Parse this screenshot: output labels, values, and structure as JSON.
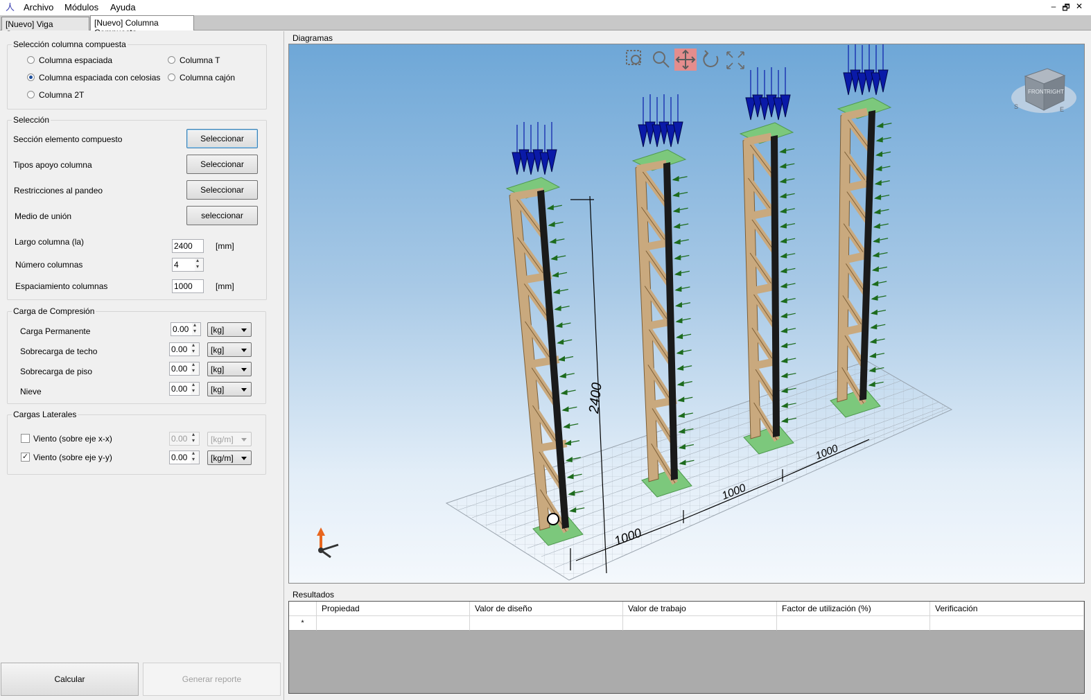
{
  "menu": {
    "archivo": "Archivo",
    "modulos": "Módulos",
    "ayuda": "Ayuda"
  },
  "window_buttons": {
    "minimize": "–",
    "restore": "🗗",
    "close": "✕"
  },
  "tabs": [
    {
      "label": "[Nuevo] Viga Compuesta",
      "active": false
    },
    {
      "label": "[Nuevo] Columna Compuesta",
      "active": true
    }
  ],
  "seleccion_columna": {
    "title": "Selección columna compuesta",
    "options": {
      "espaciada": {
        "label": "Columna espaciada",
        "checked": false
      },
      "celosias": {
        "label": "Columna espaciada con celosias",
        "checked": true
      },
      "dos_t": {
        "label": "Columna 2T",
        "checked": false
      },
      "t": {
        "label": "Columna T",
        "checked": false
      },
      "cajon": {
        "label": "Columna cajón",
        "checked": false
      }
    }
  },
  "seleccion": {
    "title": "Selección",
    "seccion": {
      "label": "Sección elemento compuesto",
      "button": "Seleccionar"
    },
    "apoyo": {
      "label": "Tipos apoyo columna",
      "button": "Seleccionar"
    },
    "pandeo": {
      "label": "Restricciones al pandeo",
      "button": "Seleccionar"
    },
    "union": {
      "label": "Medio de unión",
      "button": "seleccionar"
    },
    "largo": {
      "label": "Largo columna (la)",
      "value": "2400",
      "unit": "[mm]"
    },
    "numero": {
      "label": "Número columnas",
      "value": "4"
    },
    "espaciamiento": {
      "label": "Espaciamiento columnas",
      "value": "1000",
      "unit": "[mm]"
    }
  },
  "carga_compresion": {
    "title": "Carga de Compresión",
    "rows": {
      "permanente": {
        "label": "Carga Permanente",
        "value": "0.00",
        "unit": "[kg]"
      },
      "techo": {
        "label": "Sobrecarga de techo",
        "value": "0.00",
        "unit": "[kg]"
      },
      "piso": {
        "label": "Sobrecarga de piso",
        "value": "0.00",
        "unit": "[kg]"
      },
      "nieve": {
        "label": "Nieve",
        "value": "0.00",
        "unit": "[kg]"
      }
    }
  },
  "cargas_laterales": {
    "title": "Cargas Laterales",
    "xx": {
      "label": "Viento (sobre eje x-x)",
      "checked": false,
      "value": "0.00",
      "unit": "[kg/m]"
    },
    "yy": {
      "label": "Viento (sobre eje y-y)",
      "checked": true,
      "value": "0.00",
      "unit": "[kg/m]"
    }
  },
  "diagramas": {
    "title": "Diagramas",
    "toolbar": [
      "zoom-window-icon",
      "zoom-icon",
      "pan-icon",
      "rotate-icon",
      "fit-view-icon"
    ],
    "dimensions": {
      "height": "2400",
      "spacing1": "1000",
      "spacing2": "1000",
      "spacing3": "1000"
    },
    "view_cube": {
      "front": "FRONT",
      "right": "RIGHT",
      "s": "S",
      "e": "E"
    },
    "colors": {
      "wood": "#c9a97e",
      "dark": "#1a1a1a",
      "plate": "#7cc87c",
      "load_blue": "#0a1aa8",
      "arrow_green": "#1d6b1d"
    }
  },
  "resultados": {
    "title": "Resultados",
    "columns": [
      "Propiedad",
      "Valor de diseño",
      "Valor de trabajo",
      "Factor de utilización (%)",
      "Verificación"
    ],
    "new_row_marker": "*"
  },
  "actions": {
    "calcular": "Calcular",
    "reporte": "Generar reporte"
  }
}
